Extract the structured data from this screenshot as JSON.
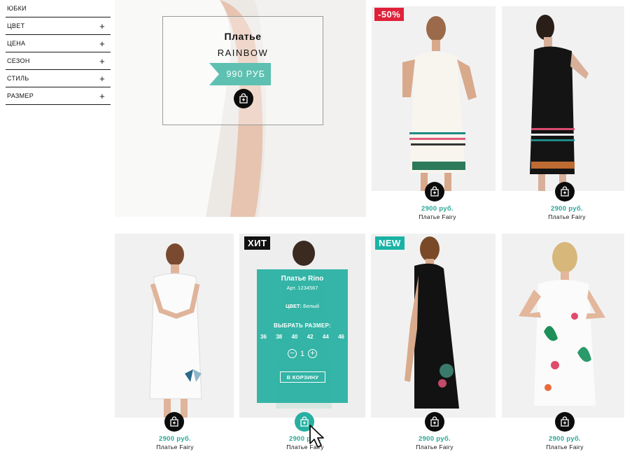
{
  "sidebar": {
    "top_label": "ЮБКИ",
    "filters": [
      {
        "label": "ЦВЕТ",
        "icon": "plus-icon",
        "symbol": "+"
      },
      {
        "label": "ЦЕНА",
        "icon": "plus-icon",
        "symbol": "+"
      },
      {
        "label": "СЕЗОН",
        "icon": "plus-icon",
        "symbol": "+"
      },
      {
        "label": "СТИЛЬ",
        "icon": "plus-icon",
        "symbol": "+"
      },
      {
        "label": "РАЗМЕР",
        "icon": "plus-icon",
        "symbol": "+"
      }
    ]
  },
  "hero": {
    "title": "Платье",
    "subtitle": "RAINBOW",
    "price": "990 РУБ"
  },
  "products": [
    {
      "badge": "-50%",
      "price": "2900 руб.",
      "name": "Платье Fairy"
    },
    {
      "badge": "",
      "price": "2900 руб.",
      "name": "Платье Fairy"
    },
    {
      "badge": "",
      "price": "2900 руб.",
      "name": "Платье Fairy"
    },
    {
      "badge": "ХИТ",
      "price": "2900 руб.",
      "name": "Платье Fairy"
    },
    {
      "badge": "NEW",
      "price": "2900 руб.",
      "name": "Платье Fairy"
    },
    {
      "badge": "",
      "price": "2900 руб.",
      "name": "Платье Fairy"
    }
  ],
  "quickview": {
    "title": "Платье Rino",
    "article": "Арт. 1234567",
    "color_label": "ЦВЕТ:",
    "color_value": "Белый",
    "size_label": "ВЫБРАТЬ РАЗМЕР:",
    "sizes": [
      "36",
      "38",
      "40",
      "42",
      "44",
      "46"
    ],
    "quantity": "1",
    "minus": "−",
    "plus": "+",
    "cart_button": "В КОРЗИНУ"
  },
  "colors": {
    "accent": "#27b0a1",
    "price": "#29a796",
    "sale_badge": "#e0213a",
    "hit_badge": "#111111",
    "new_badge": "#18b3a4"
  }
}
